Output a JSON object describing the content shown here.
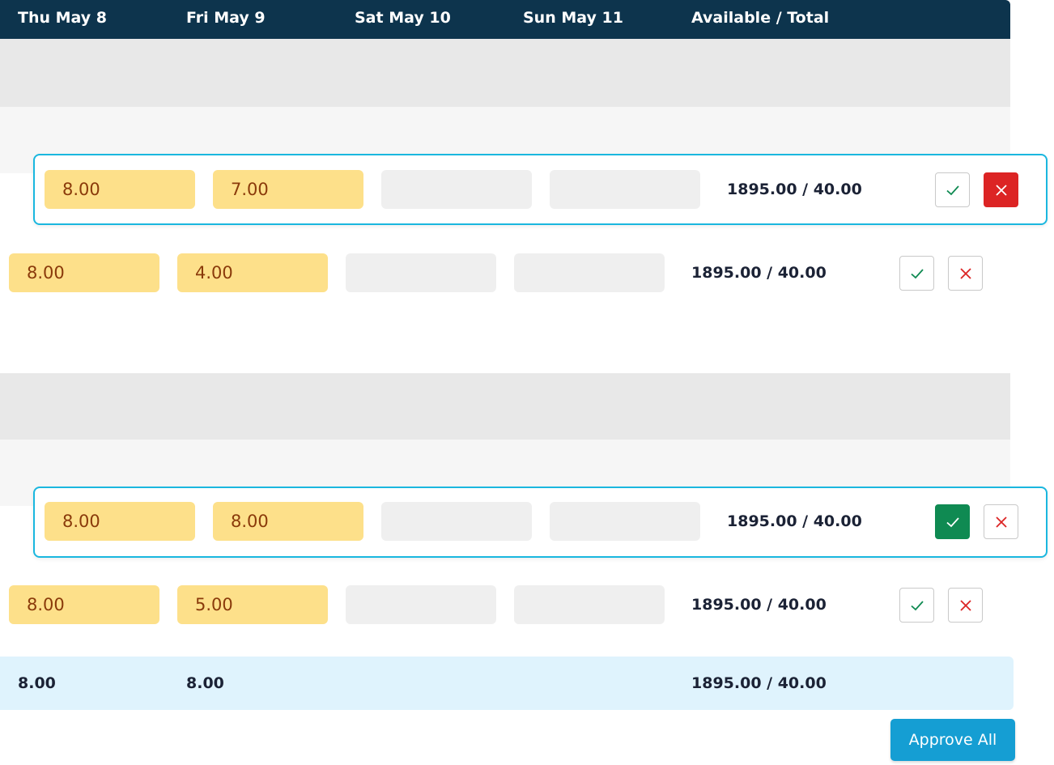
{
  "header": {
    "col1": "Thu May 8",
    "col2": "Fri May 9",
    "col3": "Sat May 10",
    "col4": "Sun May 11",
    "col5": "Available / Total"
  },
  "rows": [
    {
      "thu": "8.00",
      "fri": "7.00",
      "available": "1895.00 / 40.00",
      "state": "rejected",
      "selected": true
    },
    {
      "thu": "8.00",
      "fri": "4.00",
      "available": "1895.00 / 40.00",
      "state": "none",
      "selected": false
    },
    {
      "thu": "8.00",
      "fri": "8.00",
      "available": "1895.00 / 40.00",
      "state": "approved",
      "selected": true
    },
    {
      "thu": "8.00",
      "fri": "5.00",
      "available": "1895.00 / 40.00",
      "state": "none",
      "selected": false
    }
  ],
  "totals": {
    "thu": "8.00",
    "fri": "8.00",
    "available": "1895.00 / 40.00"
  },
  "actions": {
    "approve_all_label": "Approve All"
  },
  "icons": {
    "approve": "check-icon",
    "reject": "close-icon"
  },
  "colors": {
    "header_bg": "#0d344d",
    "selection_border": "#1ab7df",
    "hours_fill": "#fde08a",
    "approve_green": "#0f8a52",
    "reject_red": "#dc2424",
    "totals_bg": "#dff3fd",
    "approve_all_bg": "#159ed3"
  }
}
